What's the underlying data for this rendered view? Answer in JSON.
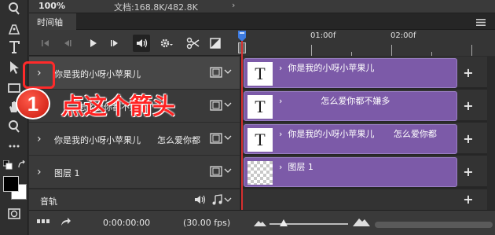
{
  "status": {
    "zoom": "100%",
    "doc_info": "文档:168.8K/482.8K",
    "arrow": "›"
  },
  "panel": {
    "tab_label": "时间轴",
    "menu_icon": "hamburger-menu-icon"
  },
  "controls": {
    "icons": [
      "skip-to-start-icon",
      "previous-frame-icon",
      "play-icon",
      "next-frame-icon",
      "audio-speaker-icon",
      "settings-gear-icon",
      "scissors-icon",
      "transition-icon"
    ]
  },
  "ruler": {
    "ticks": [
      "01:00f",
      "02:00f"
    ]
  },
  "layers": [
    {
      "chevron": "›",
      "name": "你是我的小呀小苹果儿",
      "film_icon": "filmstrip-icon"
    },
    {
      "chevron": "›",
      "name": "怎么爱你都不嫌多",
      "film_icon": "filmstrip-icon"
    },
    {
      "chevron": "›",
      "name": "你是我的小呀小苹果儿      怎么爱你都",
      "film_icon": "filmstrip-icon"
    },
    {
      "chevron": "›",
      "name": "图层 1",
      "film_icon": "filmstrip-icon"
    }
  ],
  "audio": {
    "name": "音轨",
    "volume_icon": "speaker-icon",
    "note_icon": "music-note-icon"
  },
  "clips": [
    {
      "thumb": "T",
      "text": "›  你是我的小呀小苹果儿"
    },
    {
      "thumb": "T",
      "text": "›              怎么爱你都不嫌多"
    },
    {
      "thumb": "T",
      "text": "›  你是我的小呀小苹果儿       怎么爱你都"
    },
    {
      "thumb": "",
      "text": "›  图层 1"
    }
  ],
  "add_label": "+",
  "callout": {
    "number": "1",
    "text": "点这个箭头",
    "color": "#ff2222"
  },
  "bottom": {
    "time": "0:00:00:00",
    "fps": "(30.00 fps)"
  },
  "colors": {
    "clip": "#7c5aa8",
    "playhead": "#d63030",
    "accent": "#ff2a2a"
  }
}
